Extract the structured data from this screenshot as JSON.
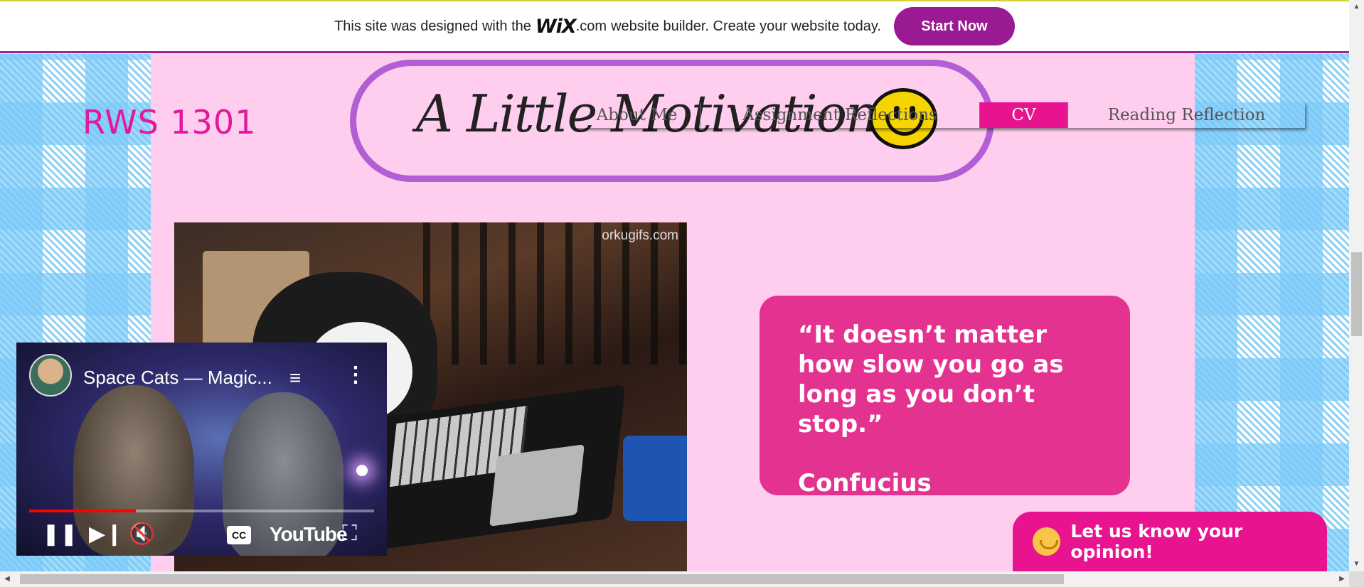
{
  "wix_banner": {
    "message_before": "This site was designed with the",
    "logo_wix": "WiX",
    "logo_com": ".com",
    "message_after": "website builder. Create your website today.",
    "start_button": "Start Now",
    "accent_color": "#9a1a93"
  },
  "site": {
    "course_title": "RWS 1301",
    "header_title": "A Little Motivation",
    "smiley_icon": "smiley-face-icon",
    "title_color": "#e01a9a"
  },
  "nav": {
    "items": [
      {
        "label": "About Me",
        "active": false
      },
      {
        "label": "Assignment Reflections",
        "active": false
      },
      {
        "label": "CV",
        "active": true
      },
      {
        "label": "Reading Reflection",
        "active": false
      }
    ],
    "active_color": "#e8138f"
  },
  "photo": {
    "watermark": "orkugifs.com"
  },
  "quote": {
    "text": "“It doesn’t matter how slow you go as long as you don’t stop.”",
    "author": "Confucius",
    "card_color": "#e3328f"
  },
  "feedback": {
    "label": "Let us know your opinion!",
    "icon": "smile-icon"
  },
  "video_player": {
    "title": "Space Cats — Magic...",
    "brand": "YouTube",
    "cc_label": "CC",
    "progress": 0.31,
    "playing": true,
    "muted": true,
    "icons": [
      "channel-avatar",
      "queue-icon",
      "more-options-icon",
      "pause-icon",
      "next-icon",
      "muted-icon",
      "captions-icon",
      "fullscreen-icon"
    ]
  }
}
